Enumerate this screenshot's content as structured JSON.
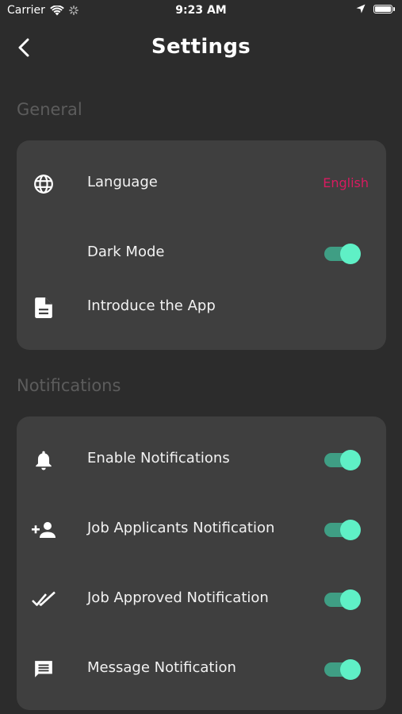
{
  "status_bar": {
    "carrier": "Carrier",
    "time": "9:23 AM"
  },
  "header": {
    "title": "Settings",
    "back_icon": "chevron-left-icon"
  },
  "general": {
    "section_title": "General",
    "items": [
      {
        "label": "Language",
        "icon": "globe-icon",
        "value": "English"
      },
      {
        "label": "Dark Mode",
        "icon": "moon-icon",
        "toggle_on": true
      },
      {
        "label": "Introduce the App",
        "icon": "document-icon"
      }
    ]
  },
  "notifications": {
    "section_title": "Notifications",
    "items": [
      {
        "label": "Enable Notifications",
        "icon": "bell-icon",
        "toggle_on": true
      },
      {
        "label": "Job Applicants Notification",
        "icon": "add-person-icon",
        "toggle_on": true
      },
      {
        "label": "Job Approved Notification",
        "icon": "double-check-icon",
        "toggle_on": true
      },
      {
        "label": "Message Notification",
        "icon": "chat-icon",
        "toggle_on": true
      }
    ]
  },
  "colors": {
    "background": "#2c2c2c",
    "card": "#3f3f3f",
    "section_title": "#5c5c5c",
    "accent_value": "#d81b60",
    "toggle_track": "#3f9e84",
    "toggle_knob": "#5ff0c6"
  }
}
